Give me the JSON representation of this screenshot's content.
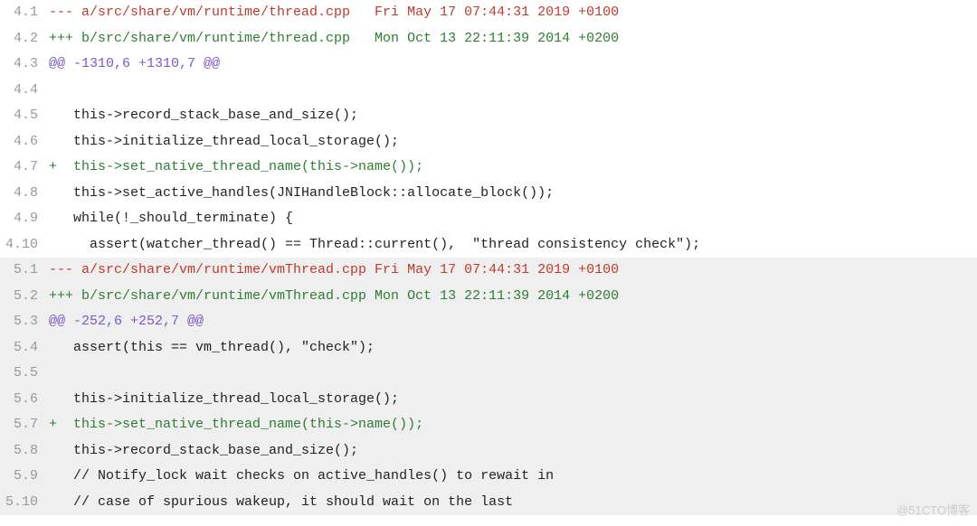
{
  "watermark": "@51CTO博客",
  "lines": [
    {
      "num": "4.1",
      "cls": "removed",
      "shaded": false,
      "text": "--- a/src/share/vm/runtime/thread.cpp   Fri May 17 07:44:31 2019 +0100"
    },
    {
      "num": "4.2",
      "cls": "added",
      "shaded": false,
      "text": "+++ b/src/share/vm/runtime/thread.cpp   Mon Oct 13 22:11:39 2014 +0200"
    },
    {
      "num": "4.3",
      "cls": "hunk",
      "shaded": false,
      "text": "@@ -1310,6 +1310,7 @@"
    },
    {
      "num": "4.4",
      "cls": "context",
      "shaded": false,
      "text": ""
    },
    {
      "num": "4.5",
      "cls": "context",
      "shaded": false,
      "text": "   this->record_stack_base_and_size();"
    },
    {
      "num": "4.6",
      "cls": "context",
      "shaded": false,
      "text": "   this->initialize_thread_local_storage();"
    },
    {
      "num": "4.7",
      "cls": "added",
      "shaded": false,
      "text": "+  this->set_native_thread_name(this->name());"
    },
    {
      "num": "4.8",
      "cls": "context",
      "shaded": false,
      "text": "   this->set_active_handles(JNIHandleBlock::allocate_block());"
    },
    {
      "num": "4.9",
      "cls": "context",
      "shaded": false,
      "text": "   while(!_should_terminate) {"
    },
    {
      "num": "4.10",
      "cls": "context",
      "shaded": false,
      "text": "     assert(watcher_thread() == Thread::current(),  \"thread consistency check\");"
    },
    {
      "num": "5.1",
      "cls": "removed",
      "shaded": true,
      "text": "--- a/src/share/vm/runtime/vmThread.cpp Fri May 17 07:44:31 2019 +0100"
    },
    {
      "num": "5.2",
      "cls": "added",
      "shaded": true,
      "text": "+++ b/src/share/vm/runtime/vmThread.cpp Mon Oct 13 22:11:39 2014 +0200"
    },
    {
      "num": "5.3",
      "cls": "hunk",
      "shaded": true,
      "text": "@@ -252,6 +252,7 @@"
    },
    {
      "num": "5.4",
      "cls": "context",
      "shaded": true,
      "text": "   assert(this == vm_thread(), \"check\");"
    },
    {
      "num": "5.5",
      "cls": "context",
      "shaded": true,
      "text": ""
    },
    {
      "num": "5.6",
      "cls": "context",
      "shaded": true,
      "text": "   this->initialize_thread_local_storage();"
    },
    {
      "num": "5.7",
      "cls": "added",
      "shaded": true,
      "text": "+  this->set_native_thread_name(this->name());"
    },
    {
      "num": "5.8",
      "cls": "context",
      "shaded": true,
      "text": "   this->record_stack_base_and_size();"
    },
    {
      "num": "5.9",
      "cls": "context",
      "shaded": true,
      "text": "   // Notify_lock wait checks on active_handles() to rewait in"
    },
    {
      "num": "5.10",
      "cls": "context",
      "shaded": true,
      "text": "   // case of spurious wakeup, it should wait on the last"
    }
  ]
}
